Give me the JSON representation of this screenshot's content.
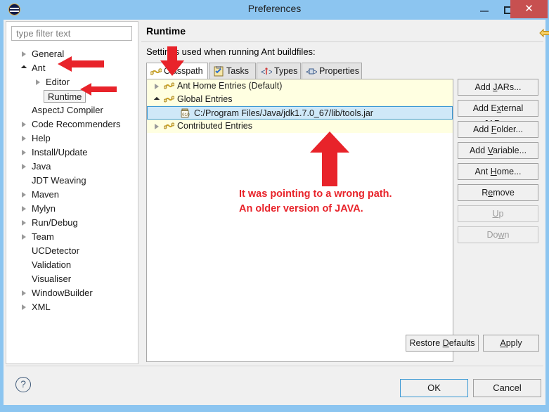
{
  "window": {
    "title": "Preferences",
    "icon": "eclipse-icon",
    "minimize_label": "–",
    "maximize_label": "□",
    "close_label": "✕",
    "titlebar_color": "#8cc5f0",
    "close_color": "#c75050"
  },
  "sidebar": {
    "filter": {
      "placeholder": "type filter text",
      "value": ""
    },
    "items": [
      {
        "label": "General",
        "level": 0,
        "twisty": "closed",
        "selected": false
      },
      {
        "label": "Ant",
        "level": 0,
        "twisty": "open",
        "selected": false
      },
      {
        "label": "Editor",
        "level": 1,
        "twisty": "closed",
        "selected": false
      },
      {
        "label": "Runtime",
        "level": 1,
        "twisty": "none",
        "selected": true
      },
      {
        "label": "AspectJ Compiler",
        "level": 0,
        "twisty": "none",
        "selected": false
      },
      {
        "label": "Code Recommenders",
        "level": 0,
        "twisty": "closed",
        "selected": false
      },
      {
        "label": "Help",
        "level": 0,
        "twisty": "closed",
        "selected": false
      },
      {
        "label": "Install/Update",
        "level": 0,
        "twisty": "closed",
        "selected": false
      },
      {
        "label": "Java",
        "level": 0,
        "twisty": "closed",
        "selected": false
      },
      {
        "label": "JDT Weaving",
        "level": 0,
        "twisty": "none",
        "selected": false
      },
      {
        "label": "Maven",
        "level": 0,
        "twisty": "closed",
        "selected": false
      },
      {
        "label": "Mylyn",
        "level": 0,
        "twisty": "closed",
        "selected": false
      },
      {
        "label": "Run/Debug",
        "level": 0,
        "twisty": "closed",
        "selected": false
      },
      {
        "label": "Team",
        "level": 0,
        "twisty": "closed",
        "selected": false
      },
      {
        "label": "UCDetector",
        "level": 0,
        "twisty": "none",
        "selected": false
      },
      {
        "label": "Validation",
        "level": 0,
        "twisty": "none",
        "selected": false
      },
      {
        "label": "Visualiser",
        "level": 0,
        "twisty": "none",
        "selected": false
      },
      {
        "label": "WindowBuilder",
        "level": 0,
        "twisty": "closed",
        "selected": false
      },
      {
        "label": "XML",
        "level": 0,
        "twisty": "closed",
        "selected": false
      }
    ]
  },
  "content": {
    "title": "Runtime",
    "description": "Settings used when running Ant buildfiles:",
    "nav": {
      "back_icon": "back-arrow-icon",
      "back_caret_icon": "chevron-down-icon",
      "forward_icon": "forward-arrow-icon",
      "forward_caret_icon": "chevron-down-icon",
      "menu_caret_icon": "chevron-down-icon"
    },
    "tabs": [
      {
        "label": "Classpath",
        "icon": "classpath-icon",
        "active": true
      },
      {
        "label": "Tasks",
        "icon": "tasks-icon",
        "active": false
      },
      {
        "label": "Types",
        "icon": "types-icon",
        "active": false
      },
      {
        "label": "Properties",
        "icon": "properties-icon",
        "active": false
      }
    ],
    "classpath_entries": [
      {
        "label": "Ant Home Entries (Default)",
        "level": 0,
        "twisty": "closed",
        "icon": "classpath-group-icon",
        "selected": false
      },
      {
        "label": "Global Entries",
        "level": 0,
        "twisty": "open",
        "icon": "classpath-group-icon",
        "selected": false
      },
      {
        "label": "C:/Program Files/Java/jdk1.7.0_67/lib/tools.jar",
        "level": 1,
        "twisty": "none",
        "icon": "jar-icon",
        "selected": true
      },
      {
        "label": "Contributed Entries",
        "level": 0,
        "twisty": "closed",
        "icon": "classpath-group-icon",
        "selected": false
      }
    ],
    "side_buttons": [
      {
        "label": "Add JARs...",
        "mnemonic": "J",
        "disabled": false
      },
      {
        "label": "Add External JARs...",
        "mnemonic": "x",
        "disabled": false
      },
      {
        "label": "Add Folder...",
        "mnemonic": "F",
        "disabled": false
      },
      {
        "label": "Add Variable...",
        "mnemonic": "V",
        "disabled": false
      },
      {
        "label": "Ant Home...",
        "mnemonic": "H",
        "disabled": false
      },
      {
        "label": "Remove",
        "mnemonic": "e",
        "disabled": false
      },
      {
        "label": "Up",
        "mnemonic": "U",
        "disabled": true
      },
      {
        "label": "Down",
        "mnemonic": "w",
        "disabled": true
      }
    ],
    "restore_defaults": {
      "label": "Restore Defaults",
      "mnemonic": "D"
    },
    "apply": {
      "label": "Apply",
      "mnemonic": "A"
    }
  },
  "footer": {
    "help_icon": "help-icon",
    "help_label": "?",
    "ok_label": "OK",
    "cancel_label": "Cancel"
  },
  "annotations": {
    "text_line1": "It was pointing to a wrong path.",
    "text_line2": "An older version of JAVA.",
    "color": "#e8232a",
    "arrows": [
      {
        "name": "arrow-pointing-to-ant",
        "direction": "left"
      },
      {
        "name": "arrow-pointing-to-runtime",
        "direction": "left"
      },
      {
        "name": "arrow-pointing-to-classpath",
        "direction": "down"
      },
      {
        "name": "arrow-pointing-to-jar-path",
        "direction": "up"
      }
    ]
  }
}
